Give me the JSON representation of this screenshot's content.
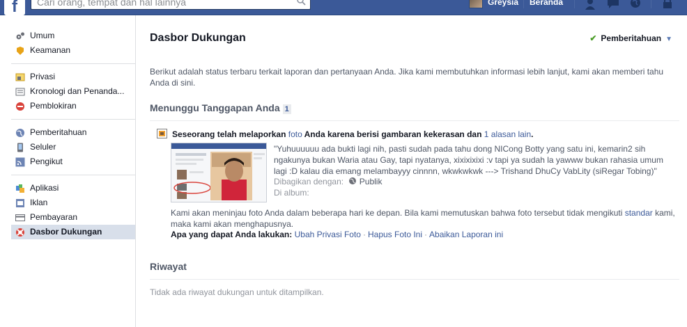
{
  "topbar": {
    "logo": "f",
    "search_placeholder": "Cari orang, tempat dan hal lainnya",
    "user_name": "Greysia",
    "home_label": "Beranda"
  },
  "sidebar": {
    "groups": [
      [
        {
          "label": "Umum",
          "icon": "gears-icon"
        },
        {
          "label": "Keamanan",
          "icon": "badge-icon"
        }
      ],
      [
        {
          "label": "Privasi",
          "icon": "lock-icon"
        },
        {
          "label": "Kronologi dan Penanda...",
          "icon": "timeline-icon"
        },
        {
          "label": "Pemblokiran",
          "icon": "block-icon"
        }
      ],
      [
        {
          "label": "Pemberitahuan",
          "icon": "globe-icon"
        },
        {
          "label": "Seluler",
          "icon": "phone-icon"
        },
        {
          "label": "Pengikut",
          "icon": "rss-icon"
        }
      ],
      [
        {
          "label": "Aplikasi",
          "icon": "app-icon"
        },
        {
          "label": "Iklan",
          "icon": "ads-icon"
        },
        {
          "label": "Pembayaran",
          "icon": "card-icon"
        },
        {
          "label": "Dasbor Dukungan",
          "icon": "lifebuoy-icon"
        }
      ]
    ]
  },
  "main": {
    "title": "Dasbor Dukungan",
    "notif_button": "Pemberitahuan",
    "intro": "Berikut adalah status terbaru terkait laporan dan pertanyaan Anda. Jika kami membutuhkan informasi lebih lanjut, kami akan memberi tahu Anda di sini.",
    "pending_heading": "Menunggu Tanggapan Anda",
    "pending_count": "1",
    "report": {
      "title_pre": "Seseorang telah melaporkan ",
      "title_link": "foto",
      "title_mid": " Anda karena berisi gambaran kekerasan dan ",
      "title_link2": "1 alasan lain",
      "title_end": ".",
      "quote": "\"Yuhuuuuuu ada bukti lagi nih, pasti sudah pada tahu dong NICong Botty yang satu ini, kemarin2 sih ngakunya bukan Waria atau Gay, tapi nyatanya, xixixixixi :v tapi ya sudah la yawww bukan rahasia umum lagi :D kalau dia emang melambayyy cinnnn, wkwkwkwk ---> Trishand DhuCy VabLity (siRegar Tobing)\"",
      "shared_label": "Dibagikan dengan:",
      "shared_value": "Publik",
      "album_label": "Di album:",
      "review_pre": "Kami akan meninjau foto Anda dalam beberapa hari ke depan. Bila kami memutuskan bahwa foto tersebut tidak mengikuti ",
      "review_link": "standar",
      "review_post": " kami, maka kami akan menghapusnya.",
      "actions_label": "Apa yang dapat Anda lakukan:",
      "action_1": "Ubah Privasi Foto",
      "action_2": "Hapus Foto Ini",
      "action_3": "Abaikan Laporan ini"
    },
    "history_heading": "Riwayat",
    "history_empty": "Tidak ada riwayat dukungan untuk ditampilkan."
  }
}
